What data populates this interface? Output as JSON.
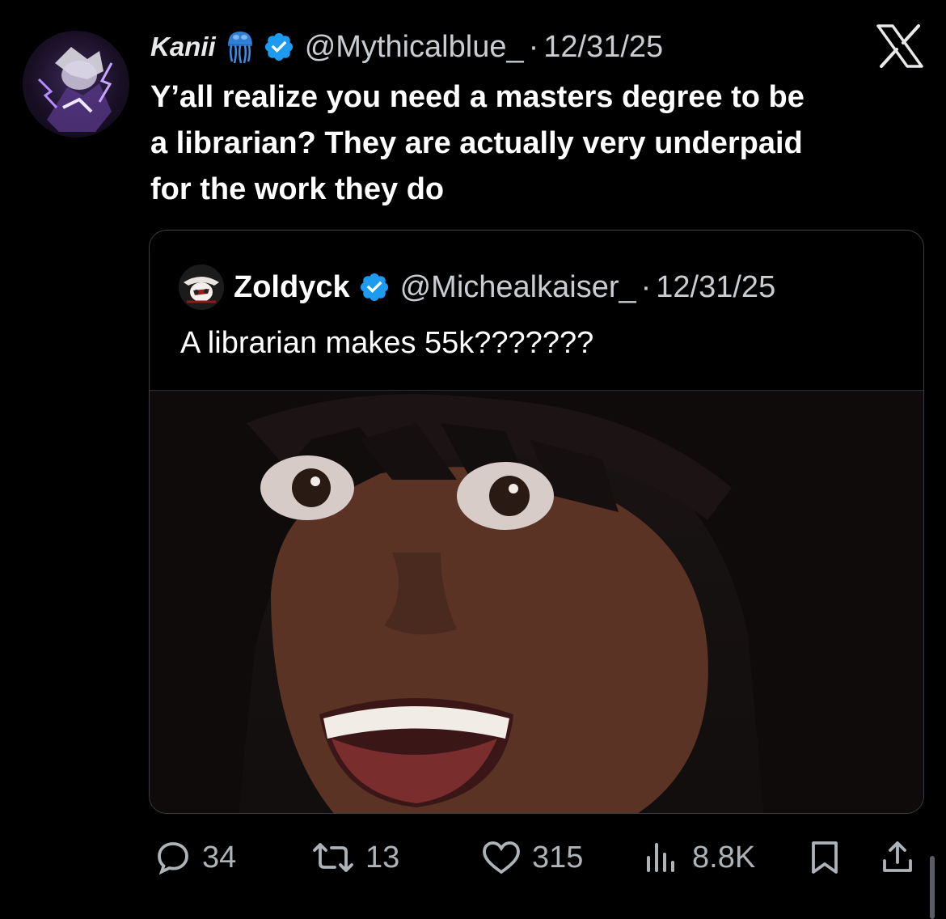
{
  "tweet": {
    "display_name": "Kanii",
    "handle": "@Mythicalblue_",
    "separator": "·",
    "date": "12/31/25",
    "text": "Y’all realize you need a masters degree to be\na librarian? They are actually very underpaid\nfor the work they do",
    "icons": {
      "emoji": "jellyfish-emoji-icon",
      "verified": "verified-badge-icon",
      "platform": "x-logo-icon"
    }
  },
  "quote": {
    "display_name": "Zoldyck",
    "handle": "@Michealkaiser_",
    "separator": "·",
    "date": "12/31/25",
    "text": "A librarian makes 55k???????"
  },
  "actions": {
    "replies": "34",
    "reposts": "13",
    "likes": "315",
    "views": "8.8K",
    "icons": [
      "reply-icon",
      "repost-icon",
      "like-icon",
      "views-icon",
      "bookmark-icon",
      "share-icon"
    ]
  },
  "colors": {
    "background": "#000000",
    "text": "#ffffff",
    "secondary": "#c9cdd1",
    "verified": "#1d9bf0",
    "border": "#3b3f44"
  }
}
